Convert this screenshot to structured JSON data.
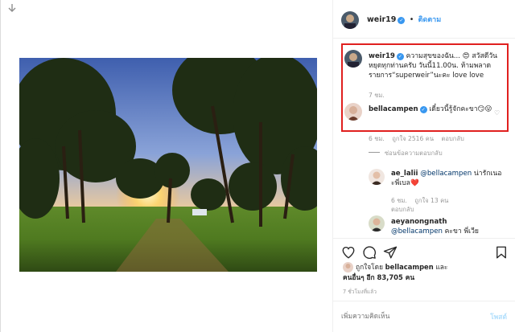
{
  "header": {
    "username": "weir19",
    "separator": "•",
    "follow_label": "ติดตาม"
  },
  "caption": {
    "username": "weir19",
    "text": "ความสุขของฉัน... 😍 สวัสดีวันหยุดทุกท่านครับ วันนี้11.00น. ห้ามพลาดรายการ“superweir”นะคะ love love",
    "time": "7 ชม."
  },
  "comments": [
    {
      "username": "bellacampen",
      "text": "เดี๋ยวนี้รู้จักคะขา😏😛",
      "time": "6 ชม.",
      "likes": "ถูกใจ 2516 คน",
      "reply_label": "ตอบกลับ",
      "view_replies": "ซ่อนข้อความตอบกลับ"
    },
    {
      "username": "ae_lalii",
      "mention": "@bellacampen",
      "text": "น่ารักเนอะพี่เบล❤️",
      "time": "6 ชม.",
      "likes": "ถูกใจ 13 คน",
      "reply_label": "ตอบกลับ"
    },
    {
      "username": "aeyanongnath",
      "mention": "@bellacampen",
      "text": "คะขา พี่เวีย"
    }
  ],
  "likes_summary": {
    "prefix": "ถูกใจโดย",
    "user": "bellacampen",
    "middle": "และ",
    "others": "คนอื่นๆ อีก 83,705 คน"
  },
  "posted_ago": "7 ชั่วโมงที่แล้ว",
  "add_comment": {
    "placeholder": "เพิ่มความคิดเห็น",
    "post_label": "โพสต์"
  },
  "colors": {
    "verified": "#3897f0",
    "highlight": "#e0201f",
    "link": "#003569",
    "muted": "#999999"
  },
  "icons": [
    "arrow-down-icon",
    "verified-icon",
    "heart-icon",
    "comment-icon",
    "share-icon",
    "bookmark-icon"
  ]
}
